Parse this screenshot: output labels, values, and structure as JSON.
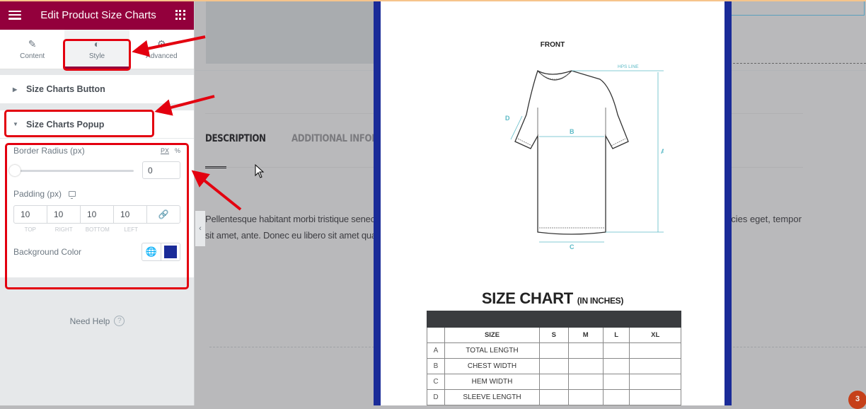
{
  "panel": {
    "title": "Edit Product Size Charts",
    "tabs": [
      {
        "label": "Content",
        "icon": "pencil-icon",
        "active": false
      },
      {
        "label": "Style",
        "icon": "half-circle-icon",
        "active": true
      },
      {
        "label": "Advanced",
        "icon": "gear-icon",
        "active": false
      }
    ],
    "sections": {
      "button": {
        "label": "Size Charts Button",
        "expanded": false
      },
      "popup": {
        "label": "Size Charts Popup",
        "expanded": true
      }
    },
    "controls": {
      "border_radius": {
        "label": "Border Radius (px)",
        "units": [
          "PX",
          "%"
        ],
        "active_unit": "PX",
        "value": "0"
      },
      "padding": {
        "label": "Padding (px)",
        "top": "10",
        "right": "10",
        "bottom": "10",
        "left": "10",
        "labels": [
          "TOP",
          "RIGHT",
          "BOTTOM",
          "LEFT"
        ]
      },
      "background_color": {
        "label": "Background Color",
        "value": "#1a2b98"
      }
    },
    "need_help": "Need Help",
    "accent_color": "#93003c"
  },
  "page": {
    "tabs": [
      "DESCRIPTION",
      "ADDITIONAL INFOR"
    ],
    "paragraph_line1": "Pellentesque habitant morbi tristique senec",
    "paragraph_line2": "sit amet, ante. Donec eu libero sit amet quar",
    "paragraph_right": "ricies eget, tempor",
    "notification_count": "3"
  },
  "popup": {
    "front_label": "FRONT",
    "diagram_labels": {
      "hps": "HPS LINE",
      "a": "A",
      "b": "B",
      "c": "C",
      "d": "D"
    },
    "chart_title": "SIZE CHART",
    "chart_unit": "(IN INCHES)",
    "table": {
      "header": [
        "",
        "SIZE",
        "S",
        "M",
        "L",
        "XL"
      ],
      "rows": [
        {
          "letter": "A",
          "name": "TOTAL LENGTH",
          "values": [
            "",
            "",
            "",
            ""
          ]
        },
        {
          "letter": "B",
          "name": "CHEST WIDTH",
          "values": [
            "",
            "",
            "",
            ""
          ]
        },
        {
          "letter": "C",
          "name": "HEM WIDTH",
          "values": [
            "",
            "",
            "",
            ""
          ]
        },
        {
          "letter": "D",
          "name": "SLEEVE LENGTH",
          "values": [
            "",
            "",
            "",
            ""
          ]
        }
      ]
    }
  }
}
